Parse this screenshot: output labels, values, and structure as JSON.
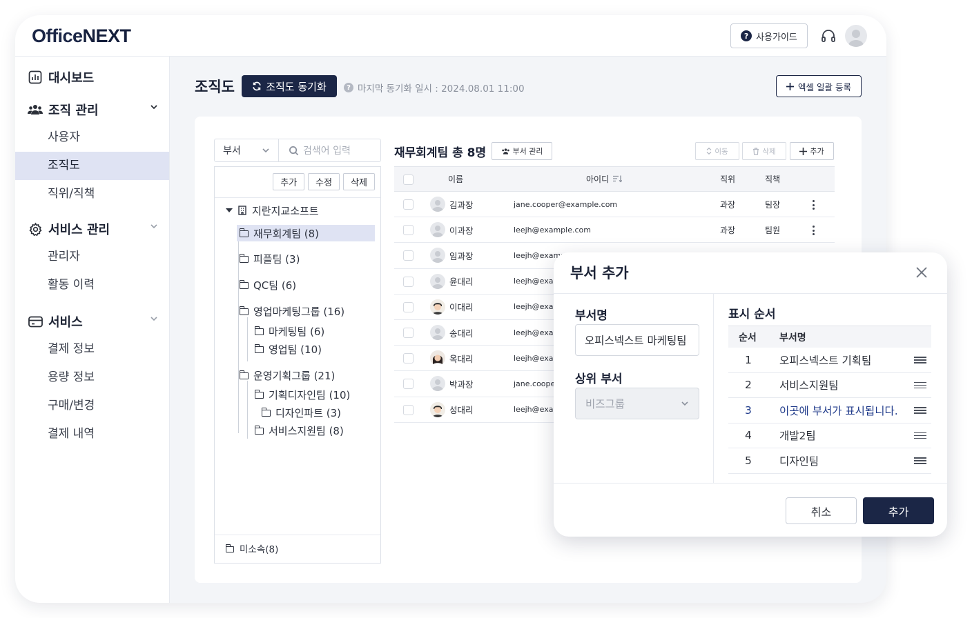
{
  "app": {
    "logo_main": "Office",
    "logo_bold": "NEXT"
  },
  "topbar": {
    "guide_label": "사용가이드"
  },
  "sidebar": {
    "groups": [
      {
        "label": "대시보드",
        "icon": "dashboard-icon",
        "items": []
      },
      {
        "label": "조직 관리",
        "icon": "users-icon",
        "items": [
          "사용자",
          "조직도",
          "직위/직책"
        ]
      },
      {
        "label": "서비스 관리",
        "icon": "gear-icon",
        "items": [
          "관리자",
          "활동 이력"
        ]
      },
      {
        "label": "서비스",
        "icon": "card-icon",
        "items": [
          "결제 정보",
          "용량 정보",
          "구매/변경",
          "결제 내역"
        ]
      }
    ],
    "active_item": "조직도"
  },
  "page": {
    "title": "조직도",
    "sync_label": "조직도 동기화",
    "sync_info": "마지막 동기화 일시 : 2024.08.01 11:00",
    "excel_label": "엑셀 일괄 등록"
  },
  "tree": {
    "select_value": "부서",
    "search_placeholder": "검색어 입력",
    "buttons": [
      "추가",
      "수정",
      "삭제"
    ],
    "root": "지란지교소프트",
    "nodes": [
      "재무회계팀 (8)",
      "피플팀 (3)",
      "QC팀 (6)",
      "영업마케팅그룹 (16)",
      "마케팅팀 (6)",
      "영업팀 (10)",
      "운영기획그룹 (21)",
      "기획디자인팀 (10)",
      "디자인파트 (3)",
      "서비스지원팀 (8)"
    ],
    "unassigned": "미소속(8)"
  },
  "team": {
    "title": "재무회계팀 총 8명",
    "manage_label": "부서 관리",
    "move_label": "이동",
    "delete_label": "삭제",
    "add_label": "추가",
    "columns": [
      "이름",
      "아이디",
      "직위",
      "직책"
    ],
    "rows": [
      {
        "name": "김과장",
        "id": "jane.cooper@example.com",
        "position": "과장",
        "role": "팀장"
      },
      {
        "name": "이과장",
        "id": "leejh@example.com",
        "position": "과장",
        "role": "팀원"
      },
      {
        "name": "임과장",
        "id": "leejh@examp",
        "position": "",
        "role": ""
      },
      {
        "name": "윤대리",
        "id": "leejh@exam",
        "position": "",
        "role": ""
      },
      {
        "name": "이대리",
        "id": "leejh@exam",
        "position": "",
        "role": ""
      },
      {
        "name": "송대리",
        "id": "leejh@exam",
        "position": "",
        "role": ""
      },
      {
        "name": "옥대리",
        "id": "leejh@exam",
        "position": "",
        "role": ""
      },
      {
        "name": "박과장",
        "id": "jane.cooper",
        "position": "",
        "role": ""
      },
      {
        "name": "성대리",
        "id": "leejh@exam",
        "position": "",
        "role": ""
      }
    ]
  },
  "modal": {
    "title": "부서 추가",
    "name_label": "부서명",
    "name_value": "오피스넥스트 마케팅팀",
    "parent_label": "상위 부서",
    "parent_value": "비즈그룹",
    "order_label": "표시 순서",
    "order_columns": [
      "순서",
      "부서명"
    ],
    "order_rows": [
      {
        "num": "1",
        "name": "오피스넥스트 기획팀"
      },
      {
        "num": "2",
        "name": "서비스지원팀"
      },
      {
        "num": "3",
        "name": "이곳에 부서가 표시됩니다."
      },
      {
        "num": "4",
        "name": "개발2팀"
      },
      {
        "num": "5",
        "name": "디자인팀"
      }
    ],
    "cancel_label": "취소",
    "add_label": "추가"
  },
  "colors": {
    "primary": "#1b2646",
    "active_bg": "#dfe3f3",
    "highlight_text": "#1f3a8a"
  }
}
